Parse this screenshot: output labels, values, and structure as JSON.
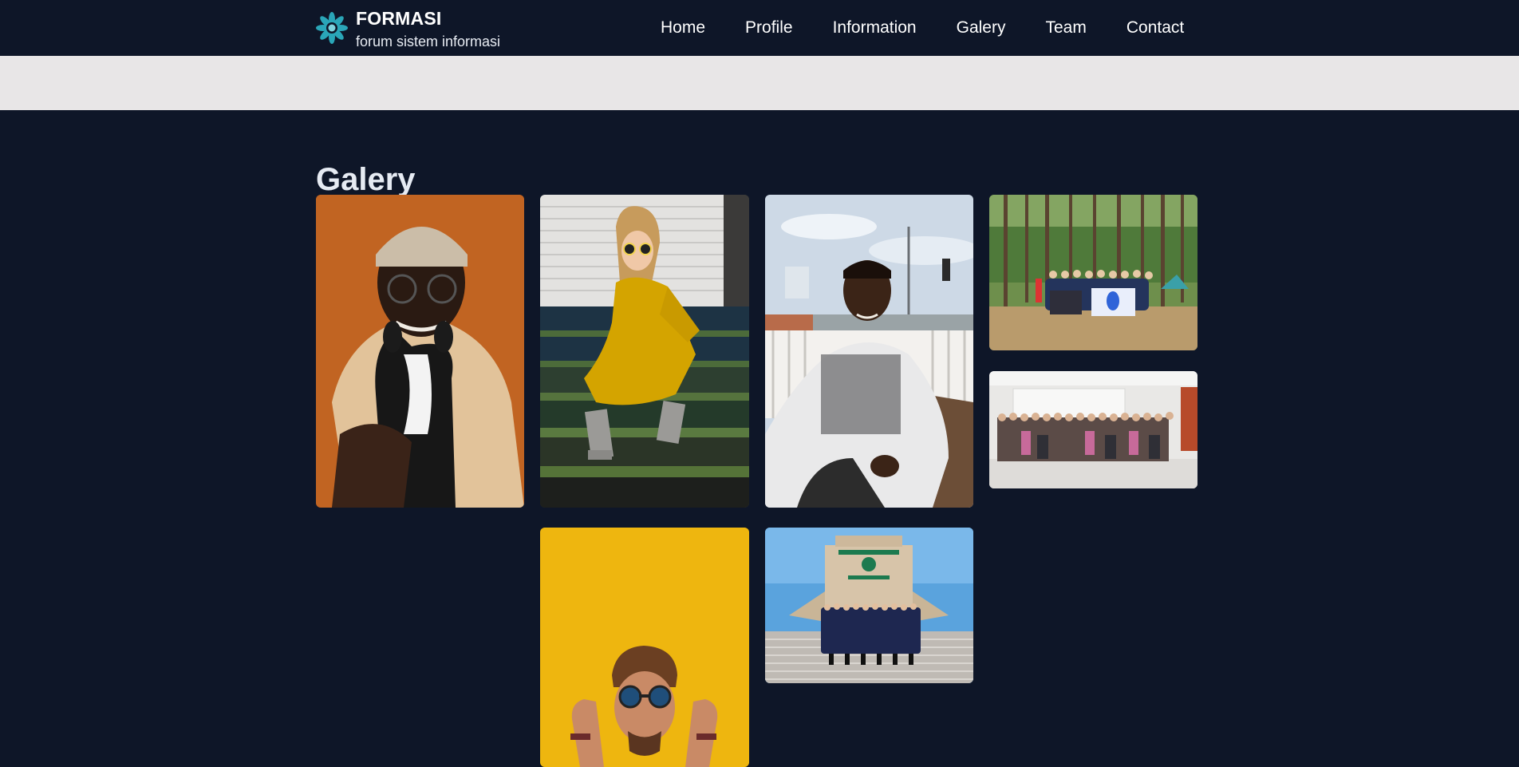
{
  "brand": {
    "name": "FORMASI",
    "tagline": "forum sistem informasi"
  },
  "nav": {
    "items": [
      {
        "label": "Home"
      },
      {
        "label": "Profile"
      },
      {
        "label": "Information"
      },
      {
        "label": "Galery"
      },
      {
        "label": "Team"
      },
      {
        "label": "Contact"
      }
    ]
  },
  "gallery": {
    "title": "Galery"
  },
  "colors": {
    "background": "#0e1628",
    "band": "#e8e6e7",
    "logo_accent": "#2aa6b8"
  },
  "icons": {
    "logo": "formasi-logo-icon"
  }
}
